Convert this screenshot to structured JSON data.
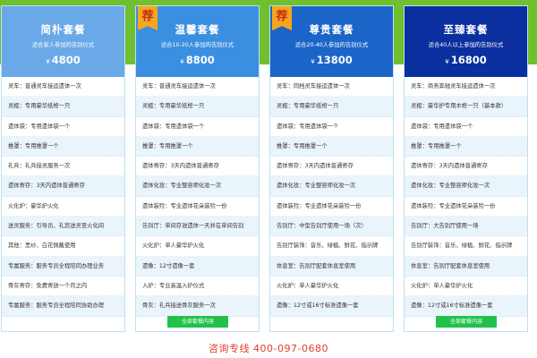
{
  "packages": [
    {
      "title": "简朴套餐",
      "subtitle": "适合家人参加的告别仪式",
      "currency": "¥",
      "price": "4800",
      "recommended": false,
      "head_color": "#6aa9e8",
      "items": [
        "灵车：普通灵车接运遗体一次",
        "灵柩：专用豪华纸棺一只",
        "遗体袋：专用遗体袋一个",
        "推罩：专用推罩一个",
        "礼兵：礼兵接灵服务一次",
        "遗体寄存：3天内遗体普通寄存",
        "火化炉：豪华炉火化",
        "送灵服务：引导员、礼宾送灵至火化间",
        "其他：黑纱、白花佩戴使用",
        "专属服务：服务专员全程陪同办理业务",
        "骨灰寄存：免费寄放一个月之内",
        "专属服务：服务专员全程陪同协助办理"
      ]
    },
    {
      "title": "温馨套餐",
      "subtitle": "适合10-20人参加的告别仪式",
      "currency": "¥",
      "price": "8800",
      "recommended": true,
      "badge": "荐",
      "head_color": "#3b8fe0",
      "items": [
        "灵车：普通灵车接运遗体一次",
        "灵柩：专用豪华纸棺一只",
        "遗体袋：专用遗体袋一个",
        "推罩：专用推罩一个",
        "遗体寄存：3天内遗体普通寄存",
        "遗体化妆：专业整容师化妆一次",
        "遗体装殓：专业遗体花朵装殓一份",
        "告别厅：单间存放遗体一天并在单间告别",
        "火化炉：单人豪华炉火化",
        "遗像：12寸遗像一套",
        "入炉：专业高温入炉仪式",
        "骨灰：礼兵接送骨灰服务一次"
      ],
      "button": "全部套餐内容"
    },
    {
      "title": "尊贵套餐",
      "subtitle": "适合20-40人参加的告别仪式",
      "currency": "¥",
      "price": "13800",
      "recommended": true,
      "badge": "荐",
      "head_color": "#1c65c8",
      "items": [
        "灵车：同档灵车接运遗体一次",
        "灵柩：专用豪华纸棺一只",
        "遗体袋：专用遗体袋一个",
        "推罩：专用推罩一个",
        "遗体寄存：3天内遗体普通寄存",
        "遗体化妆：专业整容师化妆一次",
        "遗体装殓：专业遗体花朵装殓一份",
        "告别厅：中型告别厅使用一场（次）",
        "告别厅装饰：音乐、绿植、鲜花、指示牌",
        "休息室：告别厅配套休息室使用",
        "火化炉：单人豪华炉火化",
        "遗像：12寸或16寸标准遗像一套"
      ]
    },
    {
      "title": "至臻套餐",
      "subtitle": "适合40人以上参加的告别仪式",
      "currency": "¥",
      "price": "16800",
      "recommended": false,
      "head_color": "#0b2f9e",
      "items": [
        "灵车：商务奔驰灵车接运遗体一次",
        "灵柩：豪华护专用木棺一只（基本款）",
        "遗体袋：专用遗体袋一个",
        "推罩：专用推罩一个",
        "遗体寄存：3天内遗体普通寄存",
        "遗体化妆：专业整容师化妆一次",
        "遗体装殓：专业遗体花朵装殓一份",
        "告别厅：大告别厅使用一场",
        "告别厅装饰：音乐、绿植、鲜花、指示牌",
        "休息室：告别厅配套休息室使用",
        "火化炉：单人豪华炉火化",
        "遗像：12寸或16寸标准遗像一套"
      ],
      "button": "全部套餐内容"
    }
  ],
  "hotline": "咨询专线 400-097-0680",
  "colors": {
    "band_green": "#6fbf2f",
    "button_green": "#22c14a",
    "hotline_red": "#e53a2a",
    "badge_orange": "#f6a51c"
  }
}
